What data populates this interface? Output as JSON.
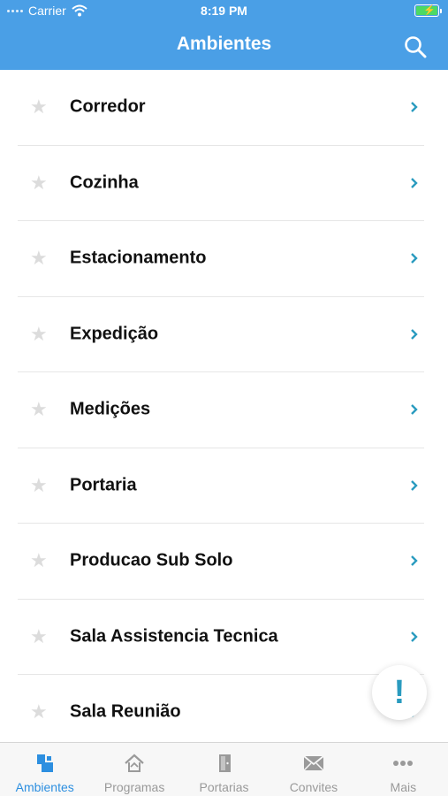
{
  "status_bar": {
    "carrier": "Carrier",
    "time": "8:19 PM"
  },
  "header": {
    "title": "Ambientes"
  },
  "list": {
    "items": [
      {
        "label": "Corredor"
      },
      {
        "label": "Cozinha"
      },
      {
        "label": "Estacionamento"
      },
      {
        "label": "Expedição"
      },
      {
        "label": "Medições"
      },
      {
        "label": "Portaria"
      },
      {
        "label": "Producao Sub Solo"
      },
      {
        "label": "Sala Assistencia Tecnica"
      },
      {
        "label": "Sala Reunião"
      }
    ]
  },
  "fab": {
    "symbol": "!"
  },
  "tabbar": {
    "tabs": [
      {
        "label": "Ambientes",
        "icon": "ambientes-icon",
        "active": true
      },
      {
        "label": "Programas",
        "icon": "programas-icon"
      },
      {
        "label": "Portarias",
        "icon": "door-icon"
      },
      {
        "label": "Convites",
        "icon": "envelope-icon"
      },
      {
        "label": "Mais",
        "icon": "more-icon"
      }
    ]
  },
  "colors": {
    "header_bg": "#4a9fe6",
    "accent": "#2d8fe0",
    "chevron": "#2a9bbf"
  }
}
